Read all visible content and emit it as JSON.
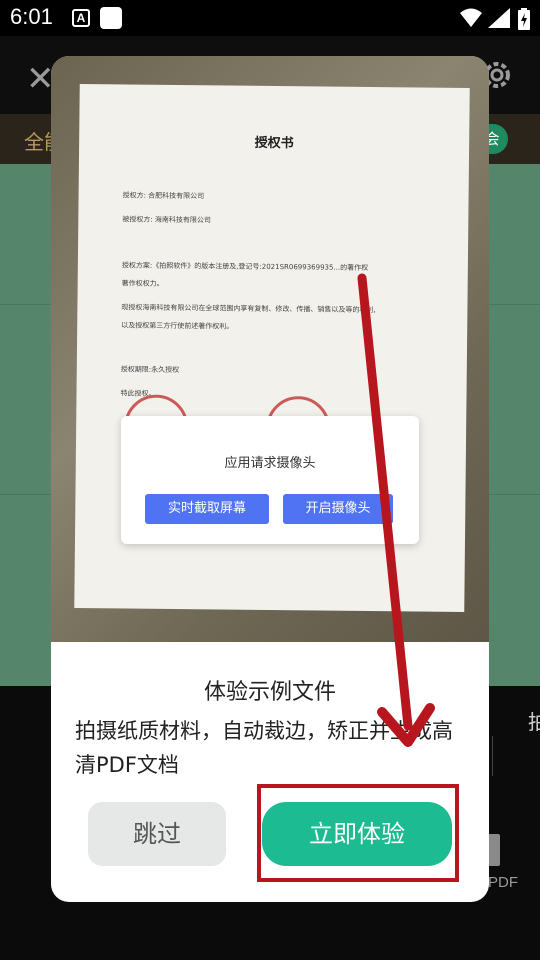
{
  "status_bar": {
    "time": "6:01",
    "a_icon_letter": "A"
  },
  "background": {
    "tab_label": "全能",
    "tab_badge": "会",
    "right_text": "拍",
    "pdf_label": "PDF"
  },
  "document_photo": {
    "title": "授权书",
    "lines": [
      "授权方:    合肥科技有限公司",
      "被授权方:   海南科技有限公司",
      "授权方案:《拍照软件》的版本注册及,登记号:2021SR0699369935...的著作权",
      "著作权权力。",
      "现授权海南科技有限公司在全球范围内享有复制、修改、传播、销售以及等的权利,",
      "以及授权第三方行使前述著作权利。",
      "授权期限:永久授权",
      "特此授权。"
    ]
  },
  "permission_dialog": {
    "message": "应用请求摄像头",
    "screen_button": "实时截取屏幕",
    "camera_button": "开启摄像头"
  },
  "dialog": {
    "title": "体验示例文件",
    "description": "拍摄纸质材料，自动裁边，矫正并生成高清PDF文档",
    "skip_label": "跳过",
    "try_label": "立即体验"
  },
  "colors": {
    "accent_green": "#1dbb91",
    "annotation_red": "#b8161e",
    "permission_blue": "#4f73f3"
  }
}
